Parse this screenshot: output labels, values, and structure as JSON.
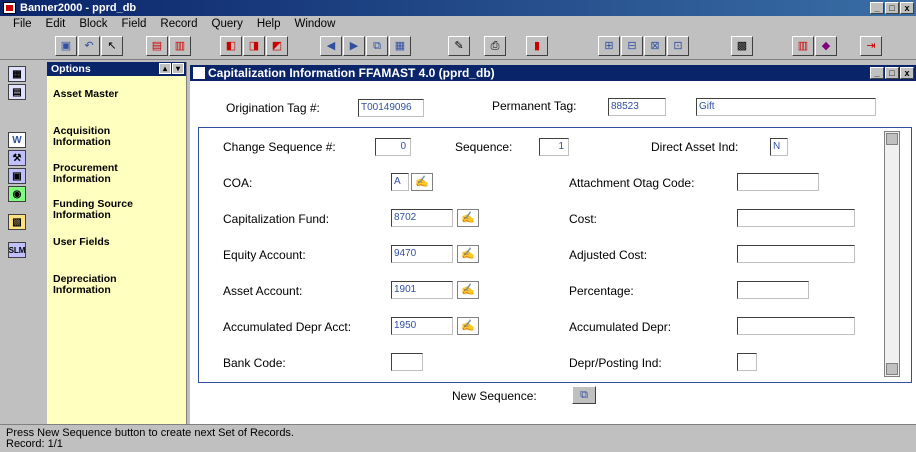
{
  "app": {
    "title": "Banner2000 - pprd_db"
  },
  "menu": [
    "File",
    "Edit",
    "Block",
    "Field",
    "Record",
    "Query",
    "Help",
    "Window"
  ],
  "options": {
    "header": "Options",
    "items": [
      "Asset Master",
      "Acquisition Information",
      "Procurement Information",
      "Funding Source Information",
      "User Fields",
      "Depreciation Information"
    ]
  },
  "form": {
    "title": "Capitalization Information FFAMAST 4.0 (pprd_db)",
    "origination_tag_label": "Origination Tag #:",
    "origination_tag_value": "T00149096",
    "permanent_tag_label": "Permanent Tag:",
    "permanent_tag_value": "88523",
    "permanent_tag_desc": "Gift",
    "change_seq_label": "Change Sequence #:",
    "change_seq_value": "0",
    "sequence_label": "Sequence:",
    "sequence_value": "1",
    "direct_asset_label": "Direct Asset Ind:",
    "direct_asset_value": "N",
    "coa_label": "COA:",
    "coa_value": "A",
    "attachment_label": "Attachment Otag Code:",
    "attachment_value": "",
    "cap_fund_label": "Capitalization Fund:",
    "cap_fund_value": "8702",
    "cost_label": "Cost:",
    "cost_value": "",
    "equity_label": "Equity Account:",
    "equity_value": "9470",
    "adj_cost_label": "Adjusted Cost:",
    "adj_cost_value": "",
    "asset_acct_label": "Asset Account:",
    "asset_acct_value": "1901",
    "percentage_label": "Percentage:",
    "percentage_value": "",
    "accum_acct_label": "Accumulated Depr Acct:",
    "accum_acct_value": "1950",
    "accum_depr_label": "Accumulated Depr:",
    "accum_depr_value": "",
    "bank_label": "Bank Code:",
    "bank_value": "",
    "depr_post_label": "Depr/Posting Ind:",
    "depr_post_value": "",
    "new_seq_label": "New Sequence:"
  },
  "status": {
    "line1": "Press New Sequence button to create next Set of Records.",
    "line2": "Record: 1/1"
  }
}
